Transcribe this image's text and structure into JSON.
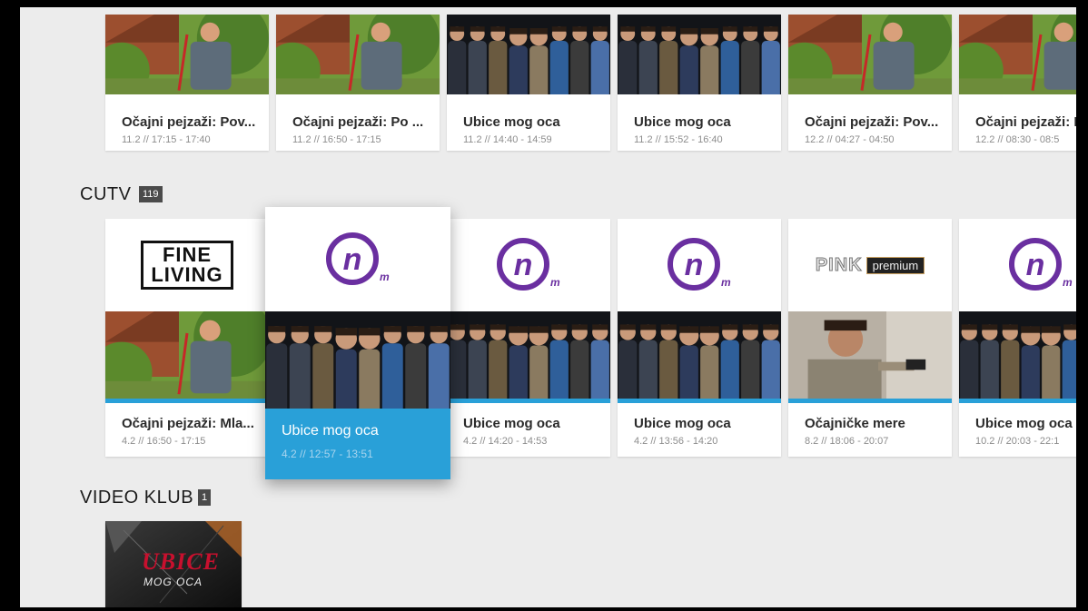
{
  "top_row": [
    {
      "title": "Očajni pejzaži: Pov...",
      "time": "11.2 // 17:15 - 17:40",
      "thumb": "garden"
    },
    {
      "title": "Očajni pejzaži: Po ...",
      "time": "11.2 // 16:50 - 17:15",
      "thumb": "garden"
    },
    {
      "title": "Ubice mog oca",
      "time": "11.2 // 14:40 - 14:59",
      "thumb": "group"
    },
    {
      "title": "Ubice mog oca",
      "time": "11.2 // 15:52 - 16:40",
      "thumb": "group"
    },
    {
      "title": "Očajni pejzaži: Pov...",
      "time": "12.2 // 04:27 - 04:50",
      "thumb": "garden"
    },
    {
      "title": "Očajni pejzaži: P",
      "time": "12.2 // 08:30 - 08:5",
      "thumb": "garden"
    }
  ],
  "cutv": {
    "label": "CUTV",
    "count": "119",
    "cards": [
      {
        "title": "Očajni pejzaži: Mla...",
        "time": "4.2 // 16:50 - 17:15",
        "thumb": "garden",
        "logo": "fine-living",
        "logo_text_1": "FINE",
        "logo_text_2": "LIVING"
      },
      {
        "title": "Ubice mog oca",
        "time": "4.2 // 12:57 - 13:51",
        "thumb": "group",
        "logo": "nova-m",
        "focused": true
      },
      {
        "title": "Ubice mog oca",
        "time": "4.2 // 14:20 - 14:53",
        "thumb": "group",
        "logo": "nova-m"
      },
      {
        "title": "Ubice mog oca",
        "time": "4.2 // 13:56 - 14:20",
        "thumb": "group",
        "logo": "nova-m"
      },
      {
        "title": "Očajničke mere",
        "time": "8.2 // 18:06 - 20:07",
        "thumb": "gunman",
        "logo": "pink-premium",
        "logo_text_1": "PINK",
        "logo_text_2": "premium"
      },
      {
        "title": "Ubice mog oca",
        "time": "10.2 // 20:03 - 22:1",
        "thumb": "group",
        "logo": "nova-m"
      }
    ]
  },
  "video_klub": {
    "label": "VIDEO KLUB",
    "count": "1",
    "poster_title": "UBICE",
    "poster_subtitle": "MOG OCA"
  },
  "colors": {
    "accent": "#29a0d8",
    "background": "#ececec",
    "logo_purple": "#6a2fa0"
  }
}
